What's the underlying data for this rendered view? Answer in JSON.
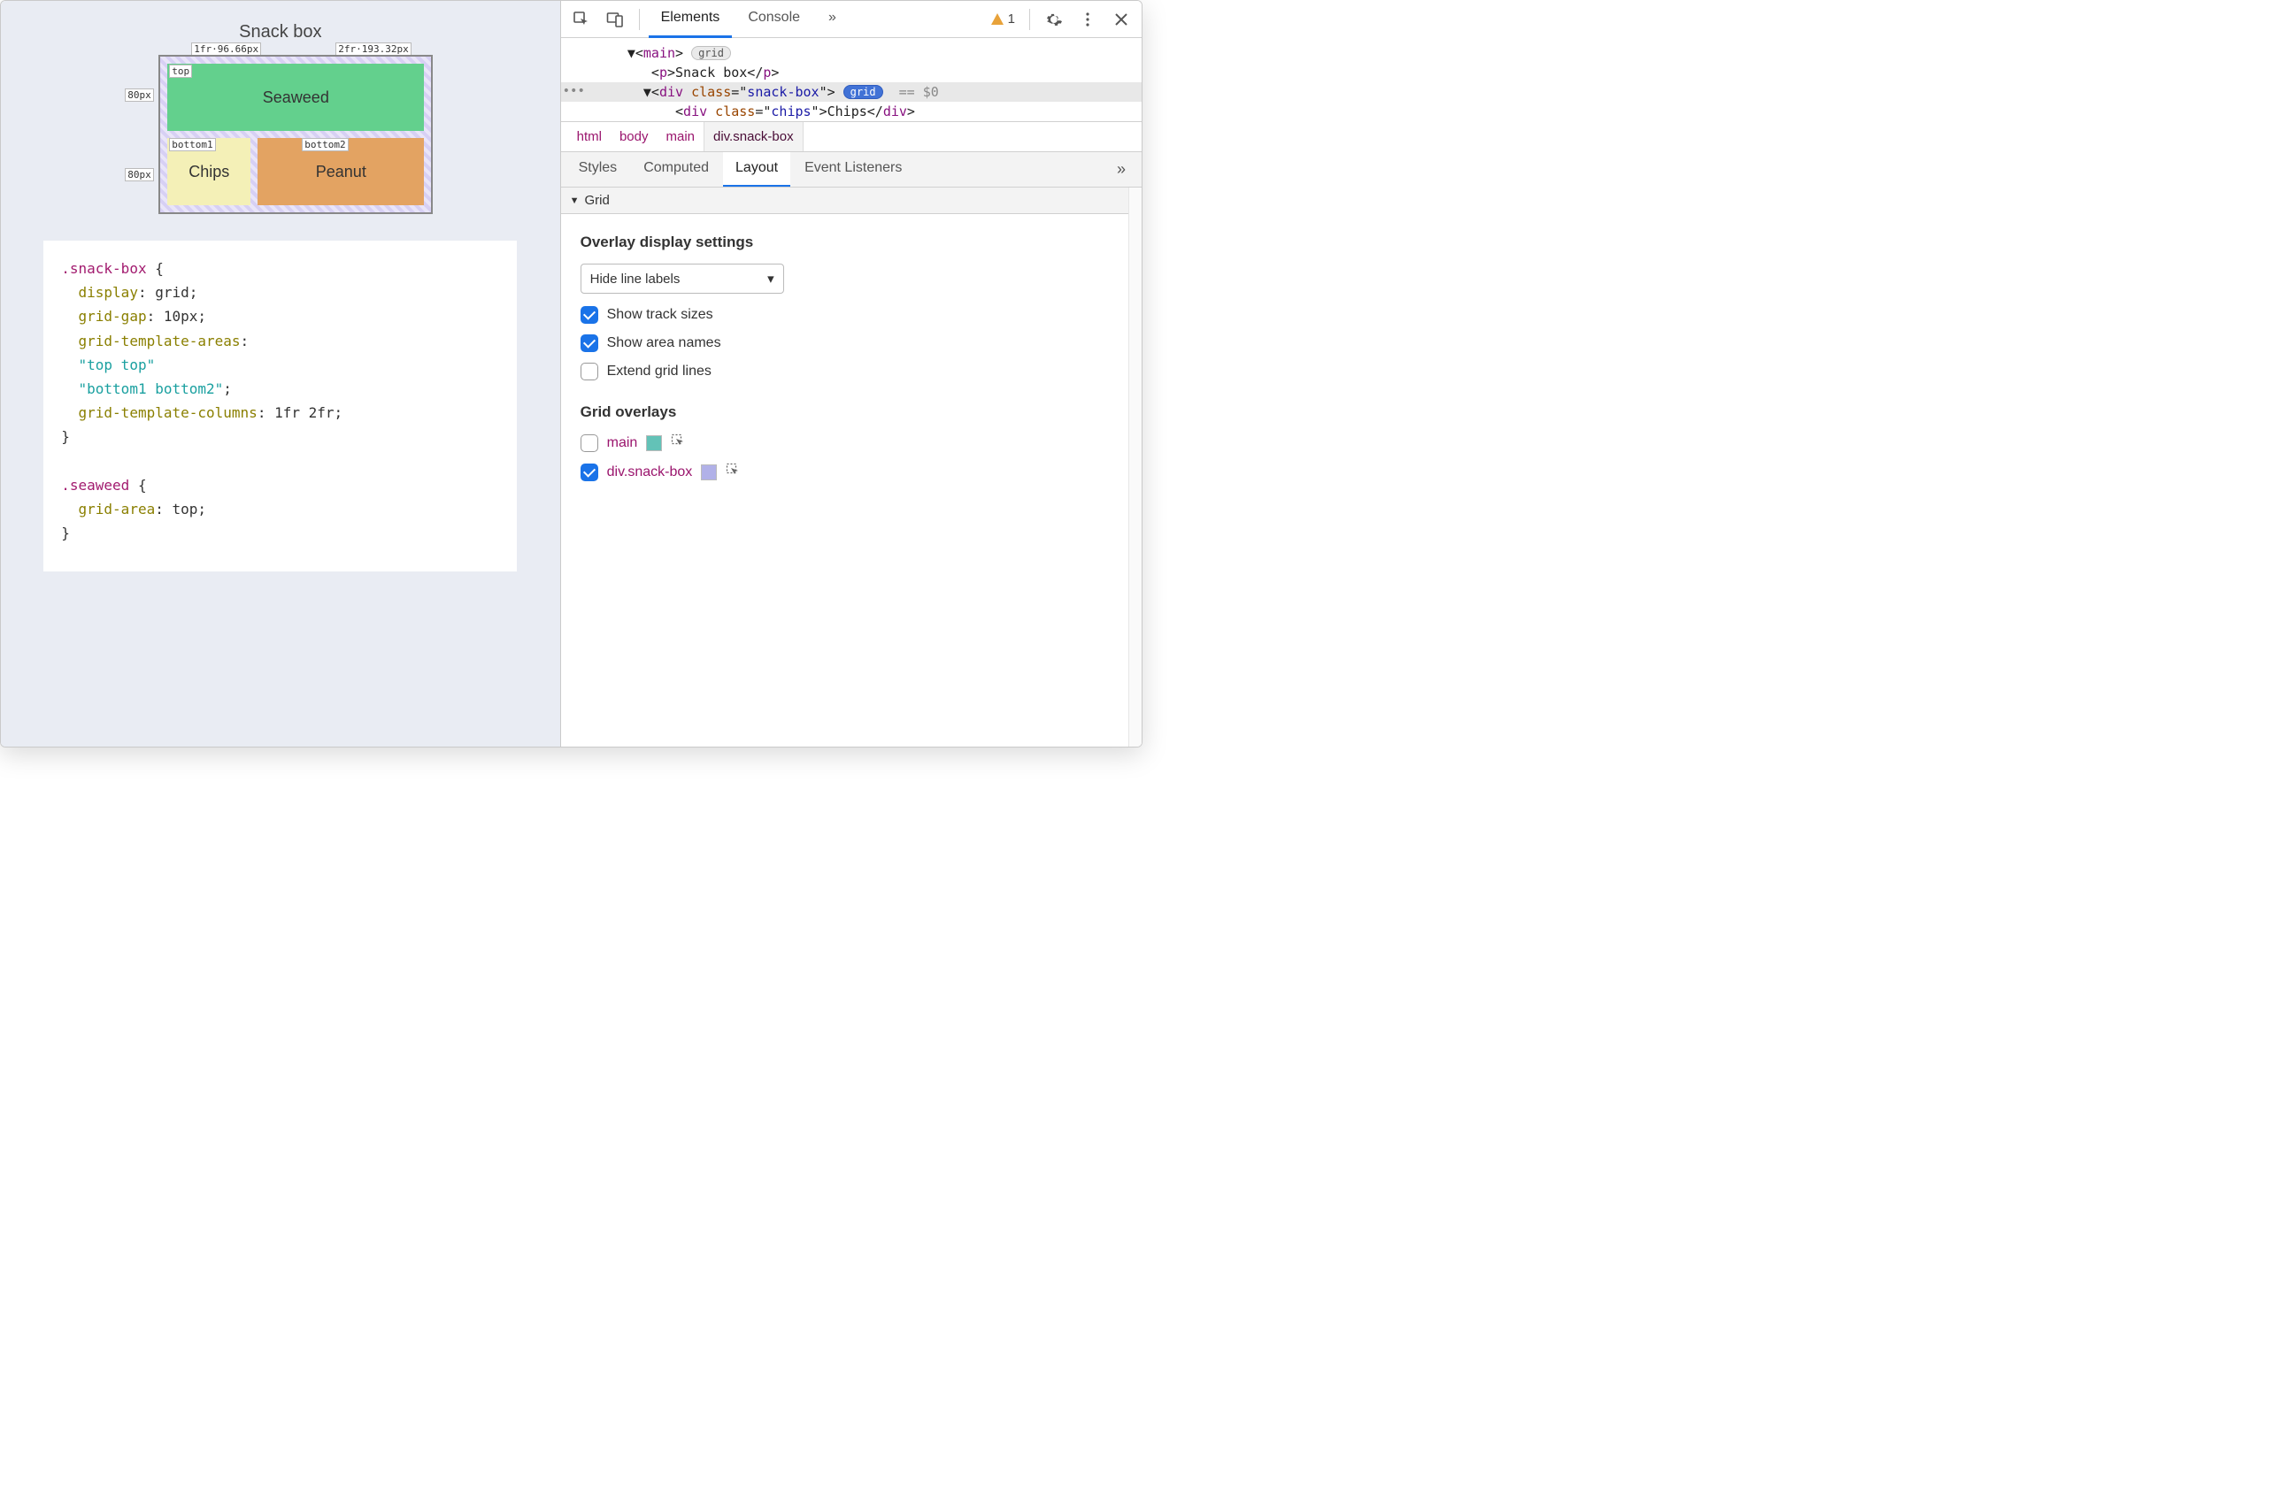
{
  "viewport": {
    "title": "Snack box",
    "col_labels": [
      "1fr·96.66px",
      "2fr·193.32px"
    ],
    "row_labels": [
      "80px",
      "80px"
    ],
    "area_names": {
      "top": "top",
      "b1": "bottom1",
      "b2": "bottom2"
    },
    "cells": {
      "seaweed": "Seaweed",
      "chips": "Chips",
      "peanut": "Peanut"
    }
  },
  "css": {
    "sel1": ".snack-box",
    "l_display_p": "display",
    "l_display_v": "grid",
    "l_gap_p": "grid-gap",
    "l_gap_v": "10px",
    "l_areas_p": "grid-template-areas",
    "l_areas_v1": "\"top top\"",
    "l_areas_v2": "\"bottom1 bottom2\"",
    "l_cols_p": "grid-template-columns",
    "l_cols_v": "1fr 2fr",
    "sel2": ".seaweed",
    "l_ga_p": "grid-area",
    "l_ga_v": "top"
  },
  "toolbar": {
    "tabs": {
      "elements": "Elements",
      "console": "Console"
    },
    "overflow": "»",
    "warn_count": "1"
  },
  "dom": {
    "main_open": "main",
    "grid_chip": "grid",
    "p_snack": "Snack box",
    "div_class": "class",
    "div_snack_box": "snack-box",
    "eq0": "== $0",
    "chips_class_v": "chips",
    "chips_text": "Chips"
  },
  "crumbs": [
    "html",
    "body",
    "main",
    "div.snack-box"
  ],
  "subtabs": {
    "styles": "Styles",
    "computed": "Computed",
    "layout": "Layout",
    "events": "Event Listeners",
    "more": "»"
  },
  "grid_section": "Grid",
  "overlay_settings": {
    "heading": "Overlay display settings",
    "dropdown": "Hide line labels",
    "show_track_sizes": "Show track sizes",
    "show_area_names": "Show area names",
    "extend_grid_lines": "Extend grid lines"
  },
  "grid_overlays": {
    "heading": "Grid overlays",
    "items": [
      {
        "name": "main",
        "checked": false,
        "swatch": "#63c2b7"
      },
      {
        "name": "div.snack-box",
        "checked": true,
        "swatch": "#b1b1e8"
      }
    ]
  }
}
